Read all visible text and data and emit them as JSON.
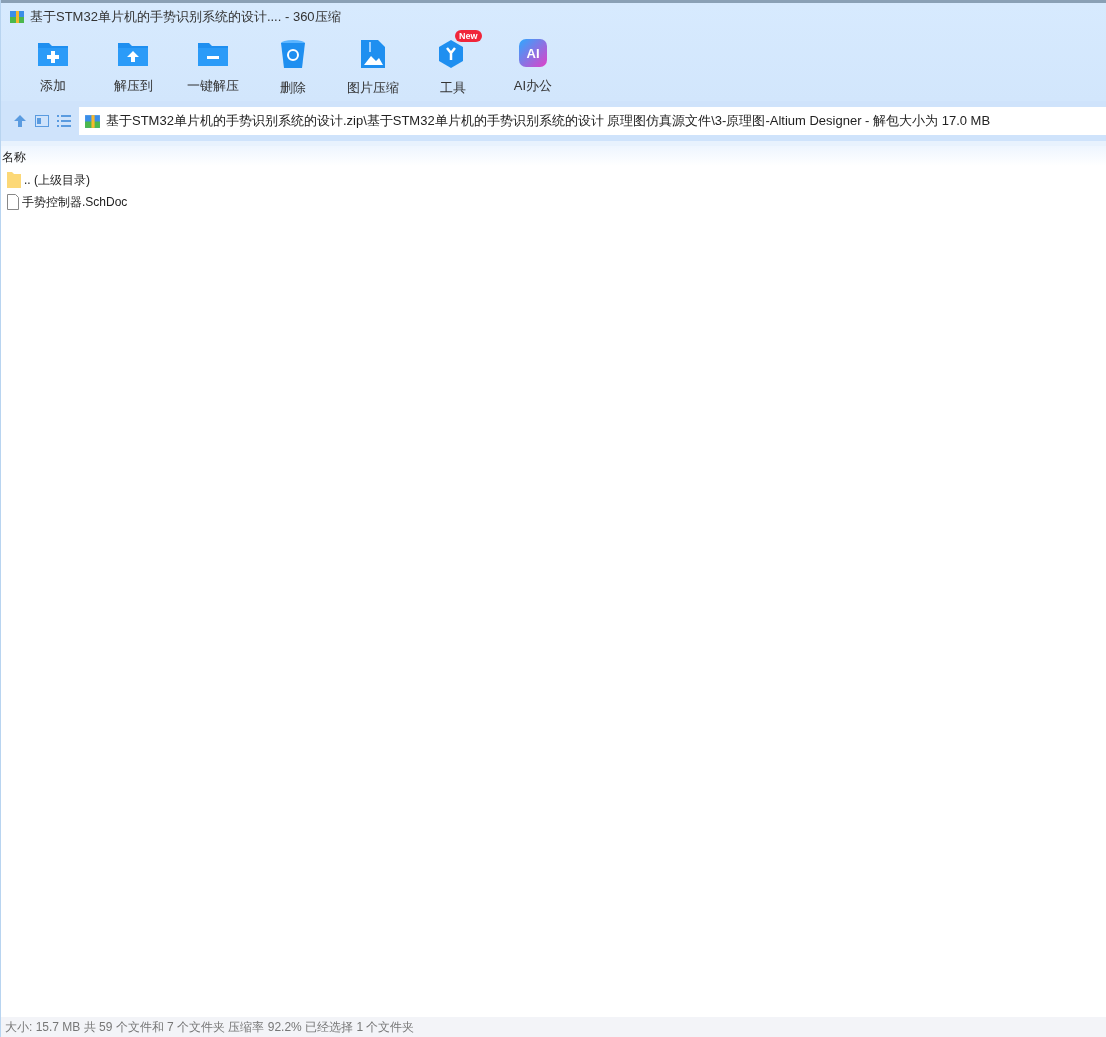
{
  "window": {
    "title": "基于STM32单片机的手势识别系统的设计.... - 360压缩"
  },
  "toolbar": [
    {
      "kind": "add",
      "label": "添加"
    },
    {
      "kind": "extract",
      "label": "解压到"
    },
    {
      "kind": "oneclick",
      "label": "一键解压"
    },
    {
      "kind": "delete",
      "label": "删除"
    },
    {
      "kind": "image",
      "label": "图片压缩"
    },
    {
      "kind": "tools",
      "label": "工具",
      "badge": "New"
    },
    {
      "kind": "ai",
      "label": "AI办公",
      "icon_text": "AI"
    }
  ],
  "address": {
    "path": "基于STM32单片机的手势识别系统的设计.zip\\基于STM32单片机的手势识别系统的设计 原理图仿真源文件\\3-原理图-Altium Designer - 解包大小为 17.0 MB"
  },
  "table": {
    "columns": [
      "名称"
    ],
    "rows": [
      {
        "kind": "folder",
        "name": ".. (上级目录)"
      },
      {
        "kind": "file",
        "name": "手势控制器.SchDoc"
      }
    ]
  },
  "status_bar": "大小: 15.7 MB 共 59 个文件和 7 个文件夹 压缩率 92.2% 已经选择 1 个文件夹"
}
